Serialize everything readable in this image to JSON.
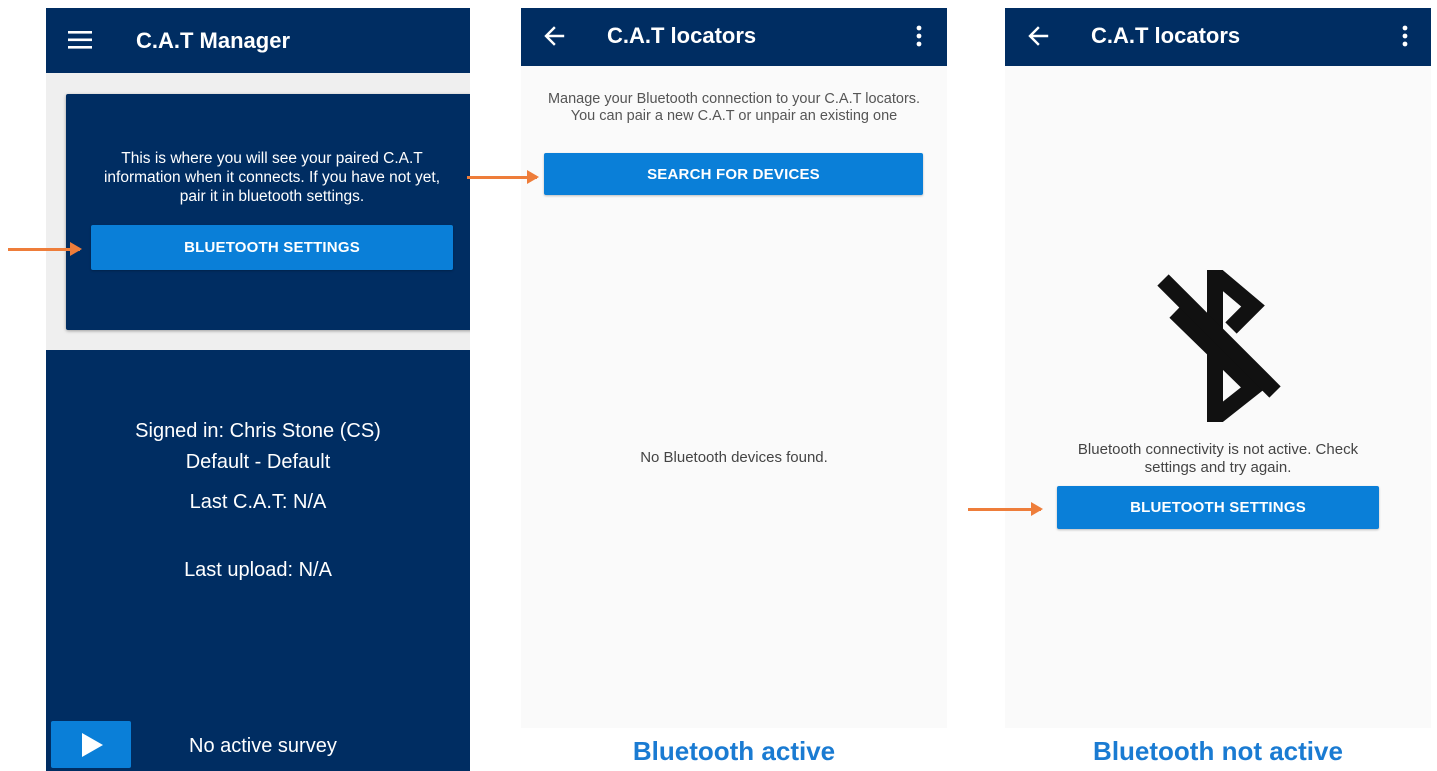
{
  "screen1": {
    "title": "C.A.T Manager",
    "card_message": "This is where you will see your paired C.A.T information when it connects. If you have not yet, pair it in bluetooth settings.",
    "bluetooth_button": "BLUETOOTH SETTINGS",
    "signed_in": "Signed in: Chris Stone (CS)",
    "default_line": "Default - Default",
    "last_cat": "Last C.A.T: N/A",
    "last_upload": "Last upload: N/A",
    "no_survey": "No active survey"
  },
  "screen2": {
    "title": "C.A.T locators",
    "intro": "Manage your Bluetooth connection to your C.A.T locators. You can pair a new C.A.T or unpair an existing one",
    "search_button": "SEARCH FOR DEVICES",
    "empty_message": "No Bluetooth devices found.",
    "caption": "Bluetooth active"
  },
  "screen3": {
    "title": "C.A.T locators",
    "message": "Bluetooth connectivity is not active. Check settings and try again.",
    "bluetooth_button": "BLUETOOTH SETTINGS",
    "caption": "Bluetooth not active"
  },
  "icons": {
    "menu": "menu-icon",
    "back": "back-arrow-icon",
    "more": "more-vert-icon",
    "play": "play-icon",
    "bluetooth_off": "bluetooth-disabled-icon"
  },
  "colors": {
    "navy": "#002d62",
    "button_blue": "#0a7fd8",
    "arrow_orange": "#ee7d3a",
    "caption_blue": "#1a7bd2",
    "light_bg": "#fafafa"
  }
}
